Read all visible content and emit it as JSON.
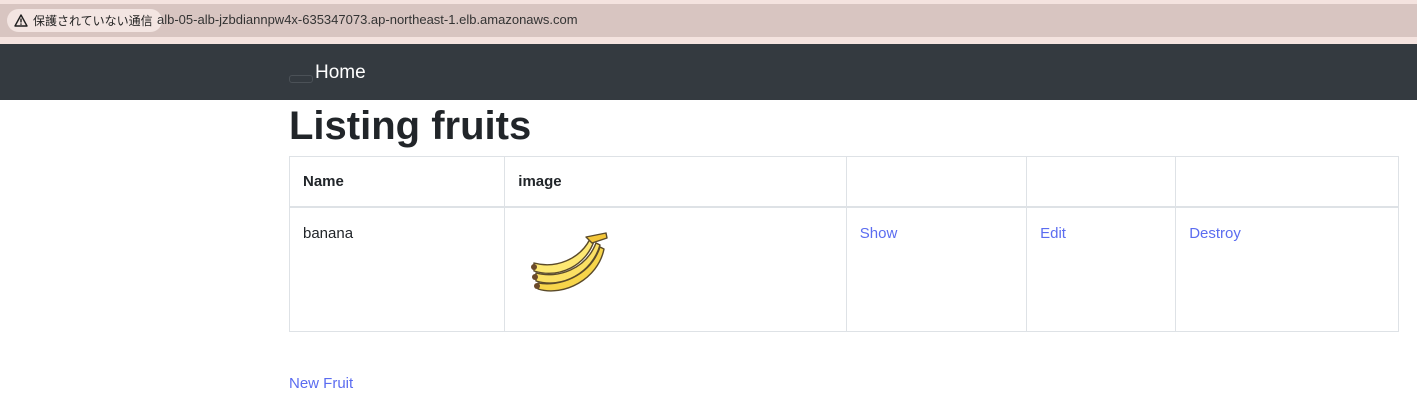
{
  "browser": {
    "security_label": "保護されていない通信",
    "url": "alb-05-alb-jzbdiannpw4x-635347073.ap-northeast-1.elb.amazonaws.com"
  },
  "navbar": {
    "home_label": "Home"
  },
  "page": {
    "title": "Listing fruits"
  },
  "table": {
    "headers": [
      "Name",
      "image",
      "",
      "",
      ""
    ],
    "rows": [
      {
        "name": "banana",
        "image_icon": "banana-icon",
        "show_label": "Show",
        "edit_label": "Edit",
        "destroy_label": "Destroy"
      }
    ]
  },
  "actions": {
    "new_label": "New Fruit"
  },
  "colors": {
    "navbar": "#343a40",
    "link": "#5b6cf0",
    "address_bar": "#d8c5c1"
  }
}
